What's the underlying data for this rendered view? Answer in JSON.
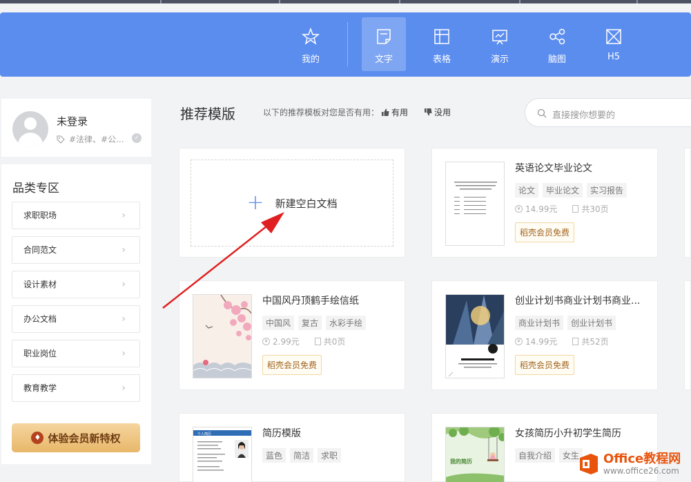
{
  "nav": {
    "tabs": [
      {
        "label": "我的",
        "icon": "star-icon"
      },
      {
        "label": "文字",
        "icon": "document-icon",
        "active": true
      },
      {
        "label": "表格",
        "icon": "table-icon"
      },
      {
        "label": "演示",
        "icon": "presentation-icon"
      },
      {
        "label": "脑图",
        "icon": "mindmap-icon"
      },
      {
        "label": "H5",
        "icon": "h5-icon"
      }
    ]
  },
  "user": {
    "name": "未登录",
    "tags": "#法律、#公..."
  },
  "categories": {
    "title": "品类专区",
    "items": [
      "求职职场",
      "合同范文",
      "设计素材",
      "办公文档",
      "职业岗位",
      "教育教学"
    ],
    "vip_label": "体验会员新特权"
  },
  "main": {
    "title": "推荐模版",
    "feedback_question": "以下的推荐模板对您是否有用：",
    "useful_label": "有用",
    "useless_label": "没用",
    "search_placeholder": "直接搜你想要的",
    "blank_label": "新建空白文档"
  },
  "templates": [
    {
      "title": "英语论文毕业论文",
      "tags": [
        "论文",
        "毕业论文",
        "实习报告"
      ],
      "price": "14.99元",
      "pages": "共30页",
      "badge": "稻壳会员免费"
    },
    {
      "title": "中国风丹顶鹤手绘信纸",
      "tags": [
        "中国风",
        "复古",
        "水彩手绘"
      ],
      "price": "2.99元",
      "pages": "共0页",
      "badge": "稻壳会员免费"
    },
    {
      "title": "创业计划书商业计划书商业...",
      "tags": [
        "商业计划书",
        "创业计划书"
      ],
      "price": "14.99元",
      "pages": "共52页",
      "badge": "稻壳会员免费"
    },
    {
      "title": "简历模版",
      "tags": [
        "蓝色",
        "简洁",
        "求职"
      ]
    },
    {
      "title": "女孩简历小升初学生简历",
      "tags": [
        "自我介绍",
        "女生"
      ]
    }
  ],
  "thumbs": {
    "resume_header": "个人简历",
    "girl_resume_title": "我的简历"
  },
  "watermark": {
    "brand": "Office教程网",
    "url": "www.office26.com"
  },
  "colors": {
    "header_blue": "#5b8def",
    "vip_gold": "#e8b76a",
    "arrow_red": "#e02020"
  }
}
